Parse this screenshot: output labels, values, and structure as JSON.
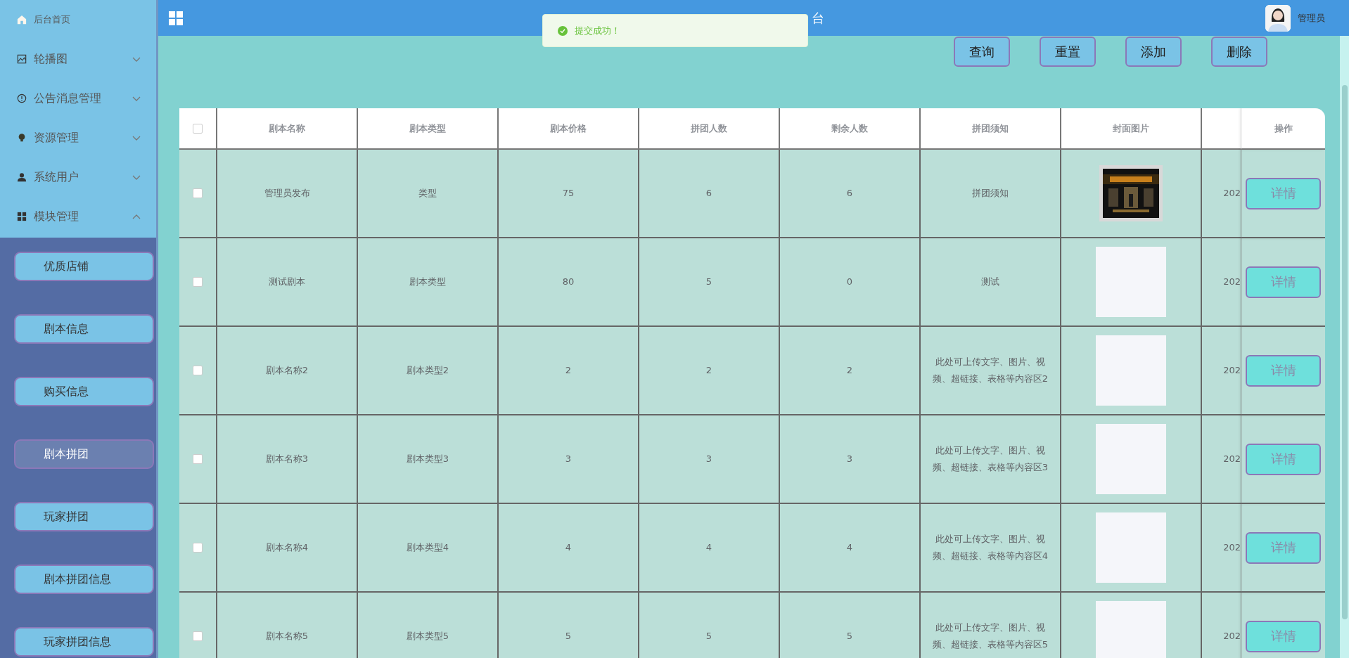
{
  "sidebar": {
    "menu": [
      {
        "label": "后台首页",
        "kind": "link"
      },
      {
        "label": "轮播图",
        "kind": "group",
        "expanded": false
      },
      {
        "label": "公告消息管理",
        "kind": "group",
        "expanded": false
      },
      {
        "label": "资源管理",
        "kind": "group",
        "expanded": false
      },
      {
        "label": "系统用户",
        "kind": "group",
        "expanded": false
      },
      {
        "label": "模块管理",
        "kind": "group",
        "expanded": true,
        "children": [
          {
            "label": "优质店铺",
            "selected": false
          },
          {
            "label": "剧本信息",
            "selected": false
          },
          {
            "label": "购买信息",
            "selected": false
          },
          {
            "label": "剧本拼团",
            "selected": true
          },
          {
            "label": "玩家拼团",
            "selected": false
          },
          {
            "label": "剧本拼团信息",
            "selected": false
          },
          {
            "label": "玩家拼团信息",
            "selected": false
          }
        ]
      }
    ]
  },
  "header": {
    "title": "台",
    "user": "管理员"
  },
  "toast": {
    "message": "提交成功！"
  },
  "toolbar": [
    "查询",
    "重置",
    "添加",
    "删除"
  ],
  "table": {
    "header_checked": false,
    "columns": [
      "剧本名称",
      "剧本类型",
      "剧本价格",
      "拼团人数",
      "剩余人数",
      "拼团须知",
      "封面图片"
    ],
    "action_column": "操作",
    "rows": [
      {
        "checked": false,
        "name": "管理员发布",
        "type": "类型",
        "price": "75",
        "group_size": "6",
        "remaining": "6",
        "notice": "拼团须知",
        "column_9": "202",
        "action": "详情"
      },
      {
        "checked": false,
        "name": "测试剧本",
        "type": "剧本类型",
        "price": "80",
        "group_size": "5",
        "remaining": "0",
        "notice": "测试",
        "cover": {
          "kind": "empty"
        },
        "column_9": "202",
        "action": "详情"
      },
      {
        "checked": false,
        "name": "剧本名称2",
        "type": "剧本类型2",
        "price": "2",
        "group_size": "2",
        "remaining": "2",
        "notice": "此处可上传文字、图片、视频、超链接、表格等内容区2",
        "cover": {
          "kind": "empty"
        },
        "column_9": "202",
        "action": "详情"
      },
      {
        "checked": false,
        "name": "剧本名称3",
        "type": "剧本类型3",
        "price": "3",
        "group_size": "3",
        "remaining": "3",
        "notice": "此处可上传文字、图片、视频、超链接、表格等内容区3",
        "cover": {
          "kind": "empty"
        },
        "column_9": "202",
        "action": "详情"
      },
      {
        "checked": false,
        "name": "剧本名称4",
        "type": "剧本类型4",
        "price": "4",
        "group_size": "4",
        "remaining": "4",
        "notice": "此处可上传文字、图片、视频、超链接、表格等内容区4",
        "cover": {
          "kind": "empty"
        },
        "column_9": "202",
        "action": "详情"
      },
      {
        "checked": false,
        "name": "剧本名称5",
        "type": "剧本类型5",
        "price": "5",
        "group_size": "5",
        "remaining": "5",
        "notice": "此处可上传文字、图片、视频、超链接、表格等内容区5",
        "cover": {
          "kind": "empty"
        },
        "column_9": "202",
        "action": "详情"
      }
    ]
  }
}
